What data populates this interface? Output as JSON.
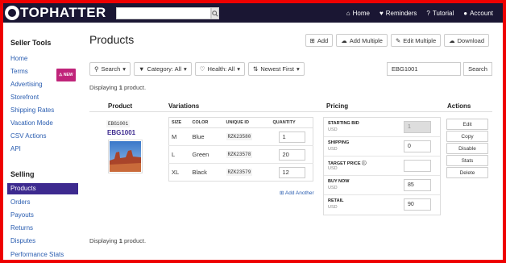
{
  "brand": {
    "logo_text": "TOPHATTER"
  },
  "header": {
    "search_placeholder": "",
    "nav": [
      {
        "label": "Home",
        "icon": "home-icon"
      },
      {
        "label": "Reminders",
        "icon": "heart-icon"
      },
      {
        "label": "Tutorial",
        "icon": "question-icon"
      },
      {
        "label": "Account",
        "icon": "user-icon"
      }
    ]
  },
  "sidebar": {
    "seller_tools_heading": "Seller Tools",
    "seller_tools": [
      "Home",
      "Terms",
      "Advertising",
      "Storefront",
      "Shipping Rates",
      "Vacation Mode",
      "CSV Actions",
      "API"
    ],
    "terms_badge": "NEW",
    "selling_heading": "Selling",
    "selling": [
      "Products",
      "Orders",
      "Payouts",
      "Returns",
      "Disputes",
      "Performance Stats"
    ],
    "active_item": "Products"
  },
  "main": {
    "title": "Products",
    "top_actions": [
      "Add",
      "Add Multiple",
      "Edit Multiple",
      "Download"
    ],
    "filters": [
      "Search",
      "Category: All",
      "Health: All",
      "Newest First"
    ],
    "sku_search_value": "EBG1001",
    "search_button": "Search",
    "displaying_prefix": "Displaying",
    "displaying_count": "1",
    "displaying_suffix": "product.",
    "columns": {
      "product": "Product",
      "variations": "Variations",
      "pricing": "Pricing",
      "actions": "Actions"
    }
  },
  "product": {
    "sku": "EBG1001",
    "name": "EBG1001",
    "image_icon": "desert-landscape-image"
  },
  "variations": {
    "headers": [
      "SIZE",
      "COLOR",
      "UNIQUE ID",
      "QUANTITY"
    ],
    "rows": [
      {
        "size": "M",
        "color": "Blue",
        "uid": "RZK23580",
        "qty": "1"
      },
      {
        "size": "L",
        "color": "Green",
        "uid": "RZK23578",
        "qty": "20"
      },
      {
        "size": "XL",
        "color": "Black",
        "uid": "RZK23579",
        "qty": "12"
      }
    ],
    "add_another": "Add Another"
  },
  "pricing": [
    {
      "label": "STARTING BID",
      "unit": "USD",
      "value": "1",
      "disabled": true
    },
    {
      "label": "SHIPPING",
      "unit": "USD",
      "value": "0",
      "disabled": false
    },
    {
      "label": "TARGET PRICE",
      "unit": "USD",
      "value": "",
      "disabled": false
    },
    {
      "label": "BUY NOW",
      "unit": "USD",
      "value": "85",
      "disabled": false
    },
    {
      "label": "RETAIL",
      "unit": "USD",
      "value": "90",
      "disabled": false
    }
  ],
  "row_actions": [
    "Edit",
    "Copy",
    "Disable",
    "Stats",
    "Delete"
  ],
  "colors": {
    "nav_bg": "#1a1633",
    "accent": "#3d2a8f",
    "link": "#2a5db0",
    "badge": "#c0247a",
    "frame": "#e00000"
  }
}
